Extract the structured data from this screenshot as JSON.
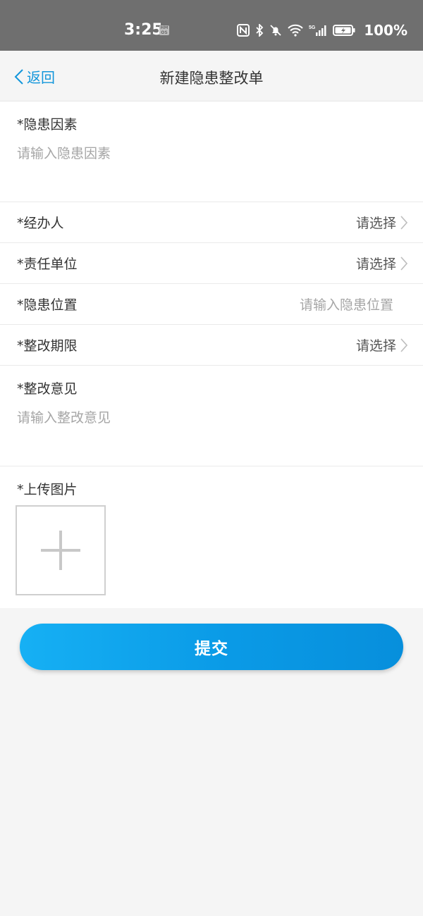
{
  "status_bar": {
    "time": "3:25",
    "hm_badge": "HM\nOS",
    "battery_pct": "100%"
  },
  "nav": {
    "back_label": "返回",
    "title": "新建隐患整改单"
  },
  "form": {
    "hazard_factor": {
      "label": "*隐患因素",
      "placeholder": "请输入隐患因素"
    },
    "handler": {
      "label": "*经办人",
      "value": "请选择"
    },
    "responsible_unit": {
      "label": "*责任单位",
      "value": "请选择"
    },
    "hazard_location": {
      "label": "*隐患位置",
      "placeholder": "请输入隐患位置"
    },
    "deadline": {
      "label": "*整改期限",
      "value": "请选择"
    },
    "rectification_opinion": {
      "label": "*整改意见",
      "placeholder": "请输入整改意见"
    },
    "upload": {
      "label": "*上传图片"
    }
  },
  "submit_label": "提交",
  "colors": {
    "accent": "#1296db",
    "status_bar": "#6f6f6f",
    "button_start": "#16b0f4",
    "button_end": "#078fdc"
  }
}
